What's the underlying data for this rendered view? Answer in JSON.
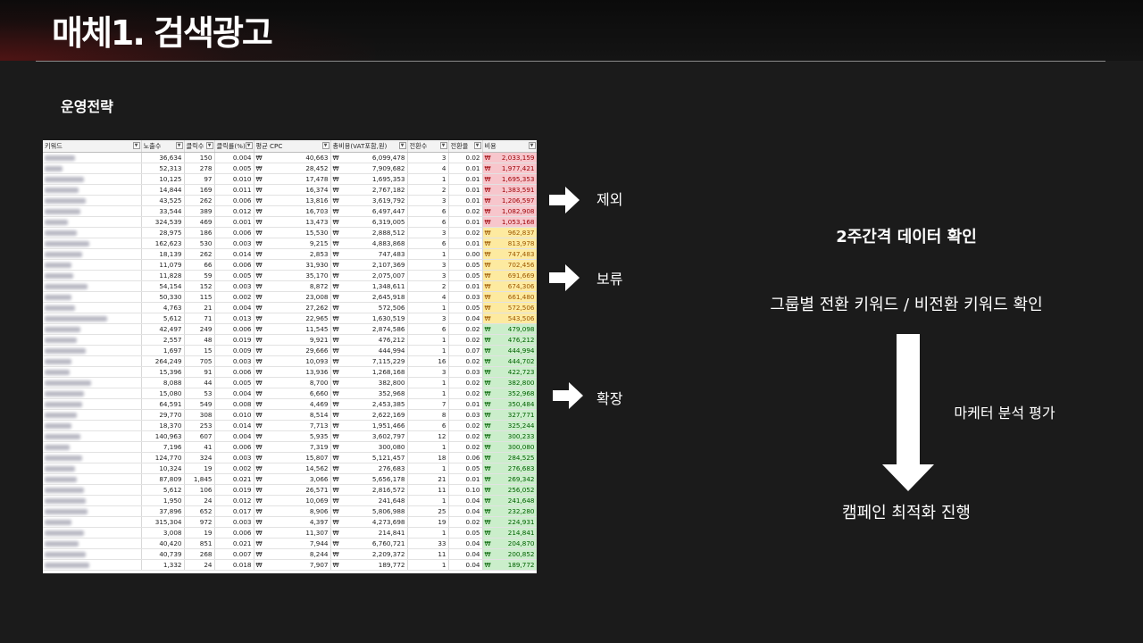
{
  "slide": {
    "title": "매체1. 검색광고",
    "subtitle": "운영전략"
  },
  "sheet": {
    "headers": [
      "키워드",
      "노출수",
      "클릭수",
      "클릭률(%)",
      "평균 CPC",
      "총비용(VAT포함,원)",
      "전환수",
      "전환율",
      "비용"
    ],
    "currency": "₩",
    "rows": [
      {
        "imp": "36,634",
        "clk": "150",
        "ctr": "0.004",
        "cpc": "40,663",
        "tot": "6,099,478",
        "cv": "3",
        "cvr": "0.02",
        "cost": "2,033,159",
        "band": "red"
      },
      {
        "imp": "52,313",
        "clk": "278",
        "ctr": "0.005",
        "cpc": "28,452",
        "tot": "7,909,682",
        "cv": "4",
        "cvr": "0.01",
        "cost": "1,977,421",
        "band": "red"
      },
      {
        "imp": "10,125",
        "clk": "97",
        "ctr": "0.010",
        "cpc": "17,478",
        "tot": "1,695,353",
        "cv": "1",
        "cvr": "0.01",
        "cost": "1,695,353",
        "band": "red"
      },
      {
        "imp": "14,844",
        "clk": "169",
        "ctr": "0.011",
        "cpc": "16,374",
        "tot": "2,767,182",
        "cv": "2",
        "cvr": "0.01",
        "cost": "1,383,591",
        "band": "red"
      },
      {
        "imp": "43,525",
        "clk": "262",
        "ctr": "0.006",
        "cpc": "13,816",
        "tot": "3,619,792",
        "cv": "3",
        "cvr": "0.01",
        "cost": "1,206,597",
        "band": "red"
      },
      {
        "imp": "33,544",
        "clk": "389",
        "ctr": "0.012",
        "cpc": "16,703",
        "tot": "6,497,447",
        "cv": "6",
        "cvr": "0.02",
        "cost": "1,082,908",
        "band": "red"
      },
      {
        "imp": "324,539",
        "clk": "469",
        "ctr": "0.001",
        "cpc": "13,473",
        "tot": "6,319,005",
        "cv": "6",
        "cvr": "0.01",
        "cost": "1,053,168",
        "band": "red"
      },
      {
        "imp": "28,975",
        "clk": "186",
        "ctr": "0.006",
        "cpc": "15,530",
        "tot": "2,888,512",
        "cv": "3",
        "cvr": "0.02",
        "cost": "962,837",
        "band": "yel"
      },
      {
        "imp": "162,623",
        "clk": "530",
        "ctr": "0.003",
        "cpc": "9,215",
        "tot": "4,883,868",
        "cv": "6",
        "cvr": "0.01",
        "cost": "813,978",
        "band": "yel"
      },
      {
        "imp": "18,139",
        "clk": "262",
        "ctr": "0.014",
        "cpc": "2,853",
        "tot": "747,483",
        "cv": "1",
        "cvr": "0.00",
        "cost": "747,483",
        "band": "yel"
      },
      {
        "imp": "11,079",
        "clk": "66",
        "ctr": "0.006",
        "cpc": "31,930",
        "tot": "2,107,369",
        "cv": "3",
        "cvr": "0.05",
        "cost": "702,456",
        "band": "yel"
      },
      {
        "imp": "11,828",
        "clk": "59",
        "ctr": "0.005",
        "cpc": "35,170",
        "tot": "2,075,007",
        "cv": "3",
        "cvr": "0.05",
        "cost": "691,669",
        "band": "yel"
      },
      {
        "imp": "54,154",
        "clk": "152",
        "ctr": "0.003",
        "cpc": "8,872",
        "tot": "1,348,611",
        "cv": "2",
        "cvr": "0.01",
        "cost": "674,306",
        "band": "yel"
      },
      {
        "imp": "50,330",
        "clk": "115",
        "ctr": "0.002",
        "cpc": "23,008",
        "tot": "2,645,918",
        "cv": "4",
        "cvr": "0.03",
        "cost": "661,480",
        "band": "yel"
      },
      {
        "imp": "4,763",
        "clk": "21",
        "ctr": "0.004",
        "cpc": "27,262",
        "tot": "572,506",
        "cv": "1",
        "cvr": "0.05",
        "cost": "572,506",
        "band": "yel"
      },
      {
        "imp": "5,612",
        "clk": "71",
        "ctr": "0.013",
        "cpc": "22,965",
        "tot": "1,630,519",
        "cv": "3",
        "cvr": "0.04",
        "cost": "543,506",
        "band": "yel"
      },
      {
        "imp": "42,497",
        "clk": "249",
        "ctr": "0.006",
        "cpc": "11,545",
        "tot": "2,874,586",
        "cv": "6",
        "cvr": "0.02",
        "cost": "479,098",
        "band": "grn"
      },
      {
        "imp": "2,557",
        "clk": "48",
        "ctr": "0.019",
        "cpc": "9,921",
        "tot": "476,212",
        "cv": "1",
        "cvr": "0.02",
        "cost": "476,212",
        "band": "grn"
      },
      {
        "imp": "1,697",
        "clk": "15",
        "ctr": "0.009",
        "cpc": "29,666",
        "tot": "444,994",
        "cv": "1",
        "cvr": "0.07",
        "cost": "444,994",
        "band": "grn"
      },
      {
        "imp": "264,249",
        "clk": "705",
        "ctr": "0.003",
        "cpc": "10,093",
        "tot": "7,115,229",
        "cv": "16",
        "cvr": "0.02",
        "cost": "444,702",
        "band": "grn"
      },
      {
        "imp": "15,396",
        "clk": "91",
        "ctr": "0.006",
        "cpc": "13,936",
        "tot": "1,268,168",
        "cv": "3",
        "cvr": "0.03",
        "cost": "422,723",
        "band": "grn"
      },
      {
        "imp": "8,088",
        "clk": "44",
        "ctr": "0.005",
        "cpc": "8,700",
        "tot": "382,800",
        "cv": "1",
        "cvr": "0.02",
        "cost": "382,800",
        "band": "grn"
      },
      {
        "imp": "15,080",
        "clk": "53",
        "ctr": "0.004",
        "cpc": "6,660",
        "tot": "352,968",
        "cv": "1",
        "cvr": "0.02",
        "cost": "352,968",
        "band": "grn"
      },
      {
        "imp": "64,591",
        "clk": "549",
        "ctr": "0.008",
        "cpc": "4,469",
        "tot": "2,453,385",
        "cv": "7",
        "cvr": "0.01",
        "cost": "350,484",
        "band": "grn"
      },
      {
        "imp": "29,770",
        "clk": "308",
        "ctr": "0.010",
        "cpc": "8,514",
        "tot": "2,622,169",
        "cv": "8",
        "cvr": "0.03",
        "cost": "327,771",
        "band": "grn"
      },
      {
        "imp": "18,370",
        "clk": "253",
        "ctr": "0.014",
        "cpc": "7,713",
        "tot": "1,951,466",
        "cv": "6",
        "cvr": "0.02",
        "cost": "325,244",
        "band": "grn"
      },
      {
        "imp": "140,963",
        "clk": "607",
        "ctr": "0.004",
        "cpc": "5,935",
        "tot": "3,602,797",
        "cv": "12",
        "cvr": "0.02",
        "cost": "300,233",
        "band": "grn"
      },
      {
        "imp": "7,196",
        "clk": "41",
        "ctr": "0.006",
        "cpc": "7,319",
        "tot": "300,080",
        "cv": "1",
        "cvr": "0.02",
        "cost": "300,080",
        "band": "grn"
      },
      {
        "imp": "124,770",
        "clk": "324",
        "ctr": "0.003",
        "cpc": "15,807",
        "tot": "5,121,457",
        "cv": "18",
        "cvr": "0.06",
        "cost": "284,525",
        "band": "grn"
      },
      {
        "imp": "10,324",
        "clk": "19",
        "ctr": "0.002",
        "cpc": "14,562",
        "tot": "276,683",
        "cv": "1",
        "cvr": "0.05",
        "cost": "276,683",
        "band": "grn"
      },
      {
        "imp": "87,809",
        "clk": "1,845",
        "ctr": "0.021",
        "cpc": "3,066",
        "tot": "5,656,178",
        "cv": "21",
        "cvr": "0.01",
        "cost": "269,342",
        "band": "grn"
      },
      {
        "imp": "5,612",
        "clk": "106",
        "ctr": "0.019",
        "cpc": "26,571",
        "tot": "2,816,572",
        "cv": "11",
        "cvr": "0.10",
        "cost": "256,052",
        "band": "grn"
      },
      {
        "imp": "1,950",
        "clk": "24",
        "ctr": "0.012",
        "cpc": "10,069",
        "tot": "241,648",
        "cv": "1",
        "cvr": "0.04",
        "cost": "241,648",
        "band": "grn"
      },
      {
        "imp": "37,896",
        "clk": "652",
        "ctr": "0.017",
        "cpc": "8,906",
        "tot": "5,806,988",
        "cv": "25",
        "cvr": "0.04",
        "cost": "232,280",
        "band": "grn"
      },
      {
        "imp": "315,304",
        "clk": "972",
        "ctr": "0.003",
        "cpc": "4,397",
        "tot": "4,273,698",
        "cv": "19",
        "cvr": "0.02",
        "cost": "224,931",
        "band": "grn"
      },
      {
        "imp": "3,008",
        "clk": "19",
        "ctr": "0.006",
        "cpc": "11,307",
        "tot": "214,841",
        "cv": "1",
        "cvr": "0.05",
        "cost": "214,841",
        "band": "grn"
      },
      {
        "imp": "40,420",
        "clk": "851",
        "ctr": "0.021",
        "cpc": "7,944",
        "tot": "6,760,721",
        "cv": "33",
        "cvr": "0.04",
        "cost": "204,870",
        "band": "grn"
      },
      {
        "imp": "40,739",
        "clk": "268",
        "ctr": "0.007",
        "cpc": "8,244",
        "tot": "2,209,372",
        "cv": "11",
        "cvr": "0.04",
        "cost": "200,852",
        "band": "grn"
      },
      {
        "imp": "1,332",
        "clk": "24",
        "ctr": "0.018",
        "cpc": "7,907",
        "tot": "189,772",
        "cv": "1",
        "cvr": "0.04",
        "cost": "189,772",
        "band": "grn"
      }
    ]
  },
  "labels": {
    "exclude": "제외",
    "hold": "보류",
    "expand": "확장"
  },
  "strategy": {
    "period": "2주간격 데이터 확인",
    "keyword_check": "그룹별 전환 키워드 / 비전환 키워드 확인",
    "evaluation": "마케터 분석 평가",
    "optimization": "캠페인 최적화 진행"
  },
  "colors": {
    "background": "#1b1b1b",
    "band_red": "#f7c6cc",
    "band_yellow": "#fdeaa0",
    "band_green": "#cbeecb"
  }
}
